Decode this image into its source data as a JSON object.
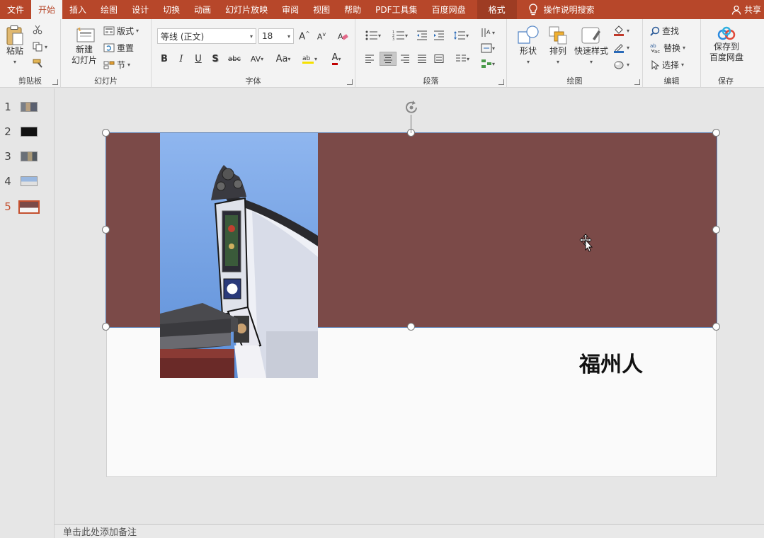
{
  "menu": {
    "tabs": [
      "文件",
      "开始",
      "插入",
      "绘图",
      "设计",
      "切换",
      "动画",
      "幻灯片放映",
      "审阅",
      "视图",
      "帮助",
      "PDF工具集",
      "百度网盘"
    ],
    "active_index": 1,
    "context_tab": "格式",
    "search_label": "操作说明搜索",
    "share_label": "共享"
  },
  "ribbon": {
    "clipboard": {
      "label": "剪贴板",
      "paste": "粘贴"
    },
    "slides": {
      "label": "幻灯片",
      "new_slide_line1": "新建",
      "new_slide_line2": "幻灯片",
      "layout": "版式",
      "reset": "重置",
      "section": "节"
    },
    "font": {
      "label": "字体",
      "font_name": "等线 (正文)",
      "font_size": "18",
      "bold": "B",
      "italic": "I",
      "underline": "U",
      "shadow": "S",
      "strike": "abc",
      "spacing": "AV",
      "case": "Aa",
      "color": "A"
    },
    "paragraph": {
      "label": "段落"
    },
    "drawing": {
      "label": "绘图",
      "shapes": "形状",
      "arrange": "排列",
      "quick_styles": "快速样式"
    },
    "editing": {
      "label": "编辑",
      "find": "查找",
      "replace": "替换",
      "select": "选择"
    },
    "save": {
      "label": "保存",
      "save_to_line1": "保存到",
      "save_to_line2": "百度网盘"
    }
  },
  "thumbnails": [
    {
      "num": "1"
    },
    {
      "num": "2"
    },
    {
      "num": "3"
    },
    {
      "num": "4"
    },
    {
      "num": "5"
    }
  ],
  "active_slide": "5",
  "slide": {
    "title": "福州人",
    "rect_color": "#7b4a48"
  },
  "notes": {
    "placeholder": "单击此处添加备注"
  },
  "colors": {
    "accent": "#b7472a",
    "active_slide": "#c4502f"
  }
}
